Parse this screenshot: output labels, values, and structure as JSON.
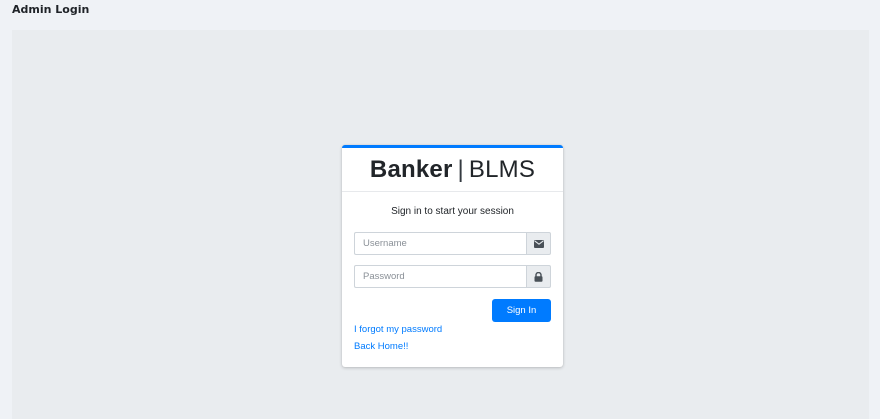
{
  "header": {
    "title": "Admin Login"
  },
  "login": {
    "brand_strong": "Banker",
    "brand_sep": "|",
    "brand_light": "BLMS",
    "message": "Sign in to start your session",
    "username": {
      "placeholder": "Username",
      "icon": "envelope-icon"
    },
    "password": {
      "placeholder": "Password",
      "icon": "lock-icon"
    },
    "submit_label": "Sign In",
    "forgot_label": "I forgot my password",
    "home_label": "Back Home!!"
  },
  "colors": {
    "accent": "#007bff",
    "page_bg": "#eff2f6",
    "stage_bg": "#e9ecef"
  }
}
